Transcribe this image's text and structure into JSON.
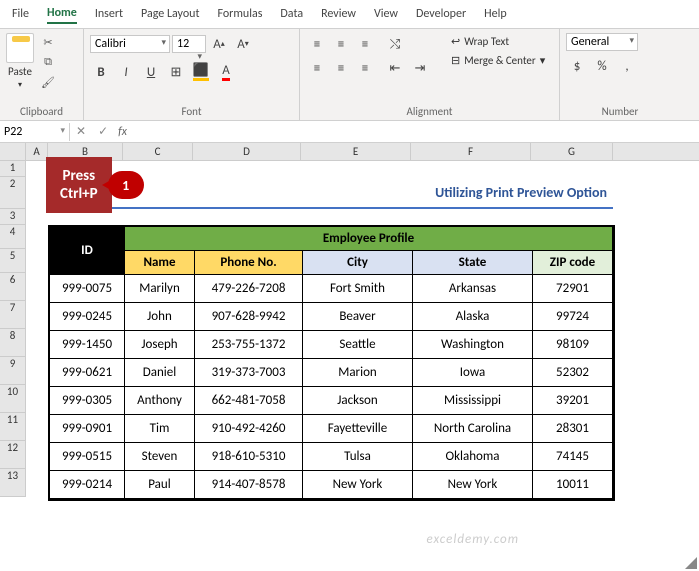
{
  "tabs": [
    "File",
    "Home",
    "Insert",
    "Page Layout",
    "Formulas",
    "Data",
    "Review",
    "View",
    "Developer",
    "Help"
  ],
  "active_tab": "Home",
  "ribbon": {
    "clipboard": {
      "label": "Clipboard",
      "paste": "Paste"
    },
    "font": {
      "label": "Font",
      "name": "Calibri",
      "size": "12",
      "bold": "B",
      "italic": "I",
      "underline": "U"
    },
    "alignment": {
      "label": "Alignment",
      "wrap": "Wrap Text",
      "merge": "Merge & Center"
    },
    "number": {
      "label": "Number",
      "format": "General"
    }
  },
  "fbar": {
    "cell": "P22",
    "fx": "fx",
    "value": ""
  },
  "columns": [
    "A",
    "B",
    "C",
    "D",
    "E",
    "F",
    "G"
  ],
  "rows": [
    "1",
    "2",
    "3",
    "4",
    "5",
    "6",
    "7",
    "8",
    "9",
    "10",
    "11",
    "12",
    "13"
  ],
  "title": "Utilizing Print Preview Option",
  "table": {
    "id_header": "ID",
    "profile_header": "Employee Profile",
    "cols": [
      "Name",
      "Phone No.",
      "City",
      "State",
      "ZIP code"
    ],
    "data": [
      {
        "id": "999-0075",
        "name": "Marilyn",
        "phone": "479-226-7208",
        "city": "Fort Smith",
        "state": "Arkansas",
        "zip": "72901"
      },
      {
        "id": "999-0245",
        "name": "John",
        "phone": "907-628-9942",
        "city": "Beaver",
        "state": "Alaska",
        "zip": "99724"
      },
      {
        "id": "999-1450",
        "name": "Joseph",
        "phone": "253-755-1372",
        "city": "Seattle",
        "state": "Washington",
        "zip": "98109"
      },
      {
        "id": "999-0621",
        "name": "Daniel",
        "phone": "319-373-7003",
        "city": "Marion",
        "state": "Iowa",
        "zip": "52302"
      },
      {
        "id": "999-0305",
        "name": "Anthony",
        "phone": "662-481-7058",
        "city": "Jackson",
        "state": "Mississippi",
        "zip": "39201"
      },
      {
        "id": "999-0901",
        "name": "Tim",
        "phone": "910-492-4260",
        "city": "Fayetteville",
        "state": "North Carolina",
        "zip": "28301"
      },
      {
        "id": "999-0515",
        "name": "Steven",
        "phone": "918-610-5310",
        "city": "Tulsa",
        "state": "Oklahoma",
        "zip": "74145"
      },
      {
        "id": "999-0214",
        "name": "Paul",
        "phone": "914-407-8578",
        "city": "New York",
        "state": "New York",
        "zip": "10011"
      }
    ]
  },
  "callout": {
    "text1": "Press",
    "text2": "Ctrl+P",
    "num": "1"
  },
  "watermark": "exceldemy.com"
}
